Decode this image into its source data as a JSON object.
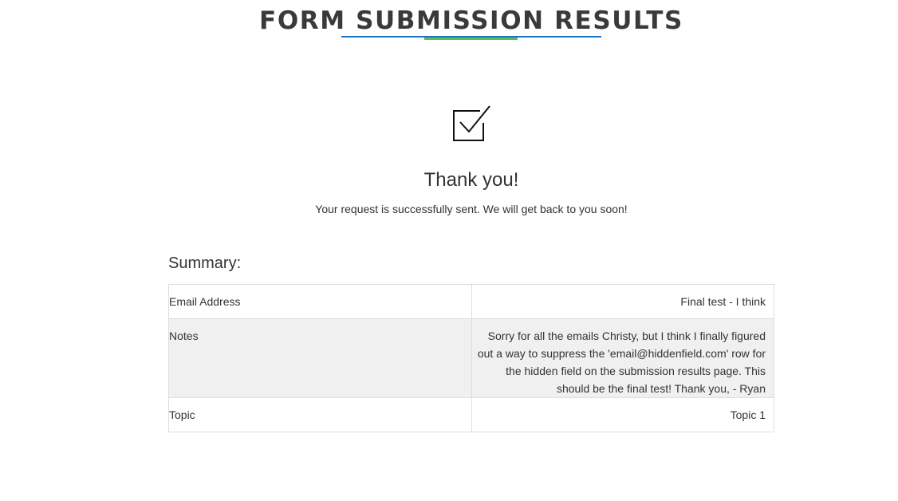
{
  "header": {
    "title": "FORM SUBMISSION RESULTS"
  },
  "confirmation": {
    "icon": "checkbox-checked-icon",
    "heading": "Thank you!",
    "message": "Your request is successfully sent. We will get back to you soon!"
  },
  "summary": {
    "heading": "Summary:",
    "rows": [
      {
        "label": "Email Address",
        "value": "Final test - I think"
      },
      {
        "label": "Notes",
        "value": "Sorry for all the emails Christy, but I think I finally figured out a way to suppress the 'email@hiddenfield.com' row for the hidden field on the submission results page. This should be the final test! Thank you, - Ryan"
      },
      {
        "label": "Topic",
        "value": "Topic 1"
      }
    ]
  },
  "colors": {
    "underline_primary": "#1a73c2",
    "underline_accent": "#5bbf4b",
    "notes_row_background": "#f0f0f0",
    "text": "#333333"
  }
}
